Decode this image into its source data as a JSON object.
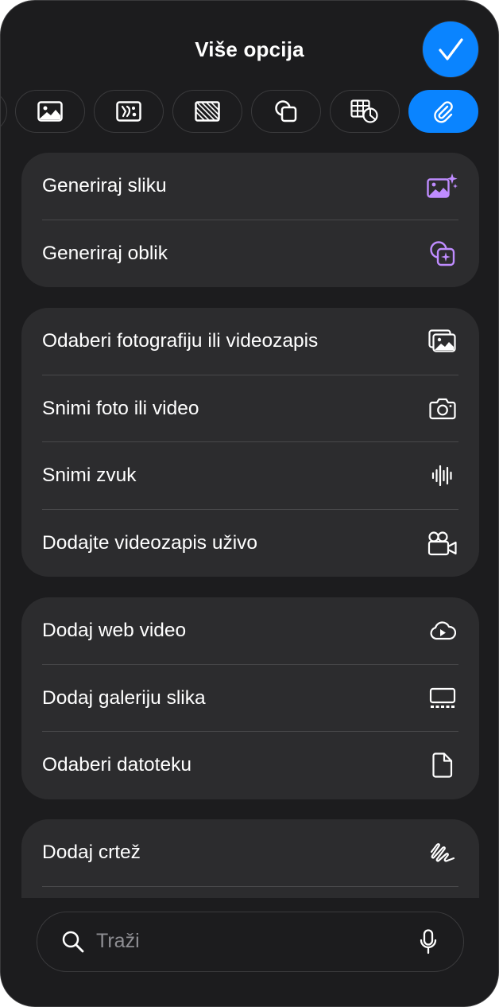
{
  "header": {
    "title": "Više opcija",
    "done_icon": "checkmark-icon"
  },
  "tabs": [
    {
      "name": "partial-tab",
      "active": false
    },
    {
      "name": "image-tab",
      "icon": "photo-icon",
      "active": false
    },
    {
      "name": "media-tab",
      "icon": "media-icon",
      "active": false
    },
    {
      "name": "pattern-tab",
      "icon": "striped-rect-icon",
      "active": false
    },
    {
      "name": "shapes-tab",
      "icon": "shapes-icon",
      "active": false
    },
    {
      "name": "table-chart-tab",
      "icon": "table-chart-icon",
      "active": false
    },
    {
      "name": "attachment-tab",
      "icon": "paperclip-icon",
      "active": true
    }
  ],
  "groups": [
    {
      "items": [
        {
          "label": "Generiraj sliku",
          "icon": "sparkle-image-icon",
          "color": "#bf8cff"
        },
        {
          "label": "Generiraj oblik",
          "icon": "sparkle-shape-icon",
          "color": "#bf8cff"
        }
      ]
    },
    {
      "items": [
        {
          "label": "Odaberi fotografiju ili videozapis",
          "icon": "photo-library-icon"
        },
        {
          "label": "Snimi foto ili video",
          "icon": "camera-icon"
        },
        {
          "label": "Snimi zvuk",
          "icon": "waveform-icon"
        },
        {
          "label": "Dodajte videozapis uživo",
          "icon": "video-camera-icon"
        }
      ]
    },
    {
      "items": [
        {
          "label": "Dodaj web video",
          "icon": "cloud-play-icon"
        },
        {
          "label": "Dodaj galeriju slika",
          "icon": "gallery-icon"
        },
        {
          "label": "Odaberi datoteku",
          "icon": "document-icon"
        }
      ]
    },
    {
      "items": [
        {
          "label": "Dodaj crtež",
          "icon": "scribble-icon"
        }
      ]
    }
  ],
  "search": {
    "placeholder": "Traži",
    "icon": "search-icon",
    "mic_icon": "microphone-icon"
  },
  "colors": {
    "accent": "#0a84ff",
    "background": "#1c1c1e",
    "card": "#2c2c2e",
    "sparkle": "#bf8cff"
  }
}
